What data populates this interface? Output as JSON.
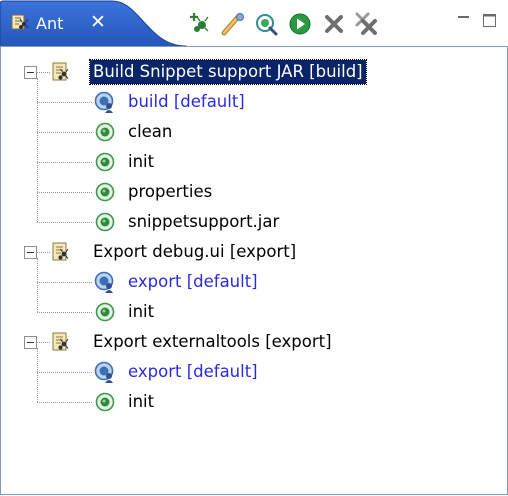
{
  "view": {
    "tab_label": "Ant",
    "tab_close_glyph": "✕",
    "tab_icon": "ant-view-icon",
    "toolbar": [
      {
        "name": "add-buildfiles-button",
        "icon": "add-buildfile-icon"
      },
      {
        "name": "add-buildfiles-with-search-button",
        "icon": "search-buildfile-icon"
      },
      {
        "name": "hide-internal-targets-button",
        "icon": "filter-targets-icon"
      },
      {
        "name": "run-target-button",
        "icon": "run-icon"
      },
      {
        "name": "remove-button",
        "icon": "remove-icon"
      },
      {
        "name": "remove-all-button",
        "icon": "remove-all-icon"
      }
    ],
    "colors": {
      "tab_active": "#2f63c8",
      "selection": "#0a246a",
      "default_target_text": "#2a2ae6",
      "border": "#7f9db9"
    }
  },
  "tree": {
    "projects": [
      {
        "label": "Build Snippet support JAR [build]",
        "selected": true,
        "expanded": true,
        "targets": [
          {
            "label": "build [default]",
            "is_default": true
          },
          {
            "label": "clean",
            "is_default": false
          },
          {
            "label": "init",
            "is_default": false
          },
          {
            "label": "properties",
            "is_default": false
          },
          {
            "label": "snippetsupport.jar",
            "is_default": false
          }
        ]
      },
      {
        "label": "Export debug.ui [export]",
        "selected": false,
        "expanded": true,
        "targets": [
          {
            "label": "export [default]",
            "is_default": true
          },
          {
            "label": "init",
            "is_default": false
          }
        ]
      },
      {
        "label": "Export externaltools [export]",
        "selected": false,
        "expanded": true,
        "targets": [
          {
            "label": "export [default]",
            "is_default": true
          },
          {
            "label": "init",
            "is_default": false
          }
        ]
      }
    ]
  }
}
